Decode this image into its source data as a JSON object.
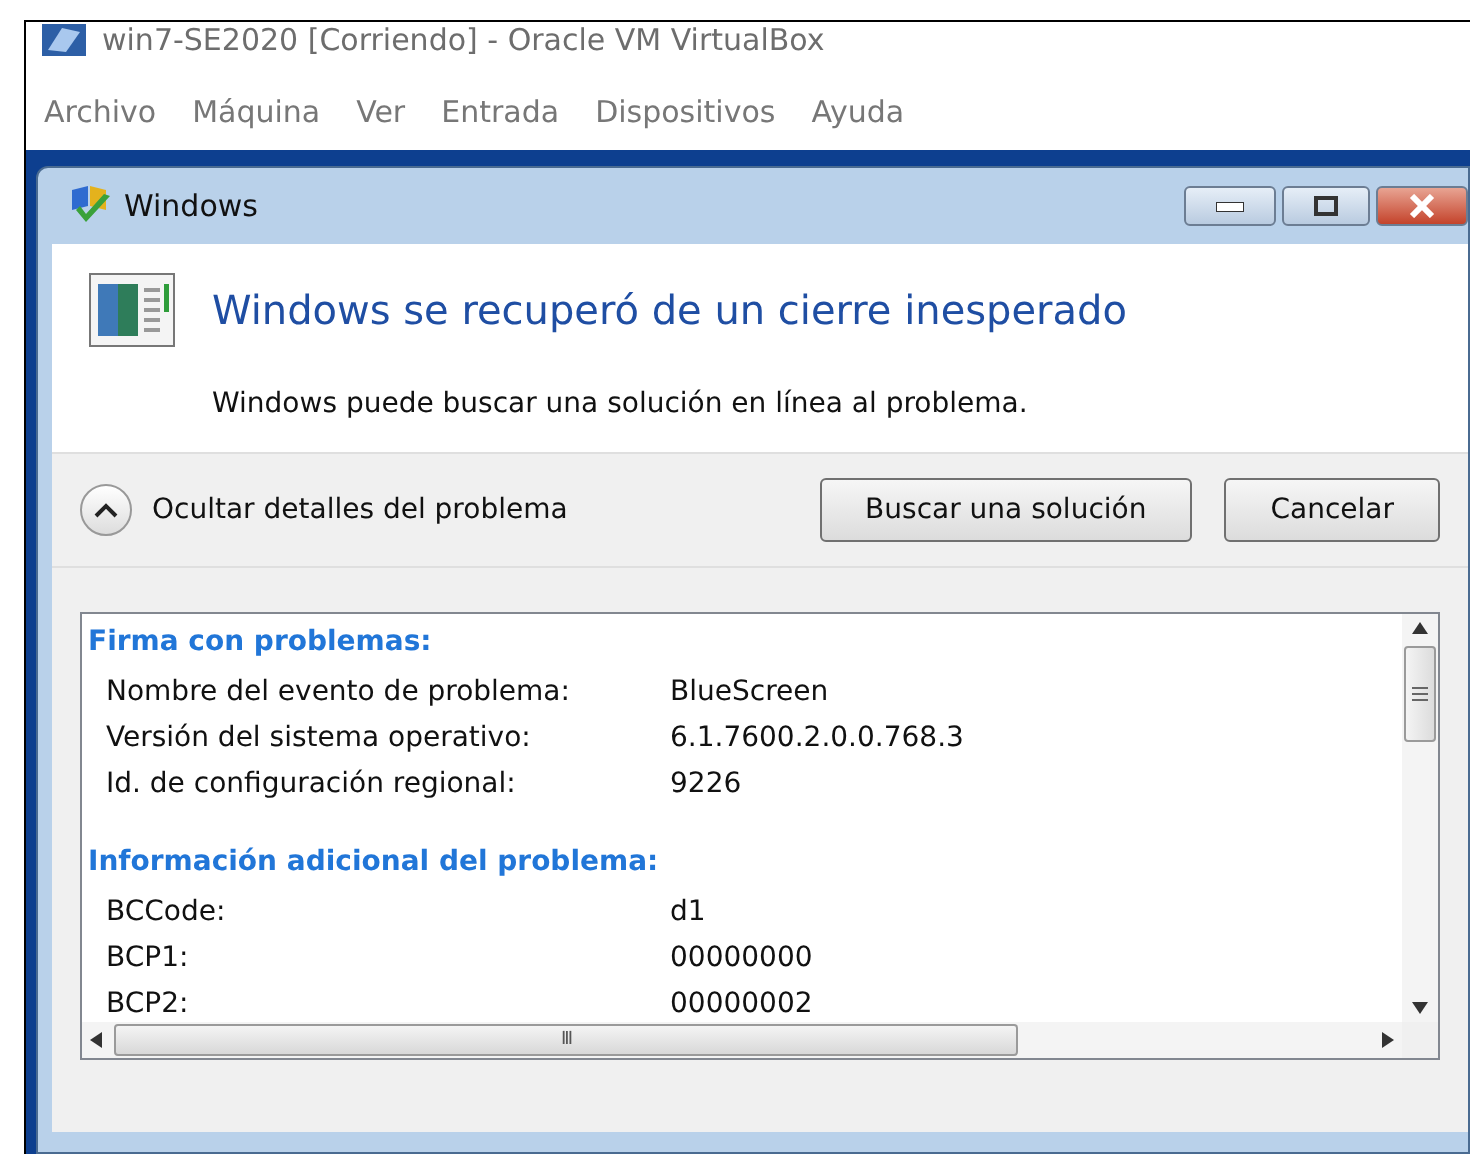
{
  "window": {
    "title": "win7-SE2020 [Corriendo] - Oracle VM VirtualBox"
  },
  "menu": [
    "Archivo",
    "Máquina",
    "Ver",
    "Entrada",
    "Dispositivos",
    "Ayuda"
  ],
  "dialog": {
    "title": "Windows",
    "heading": "Windows se recuperó de un cierre inesperado",
    "message": "Windows puede buscar una solución en línea al problema.",
    "details_toggle": {
      "label": "Ocultar detalles del problema",
      "expanded": true
    },
    "buttons": [
      "Buscar una solución",
      "Cancelar"
    ],
    "details": [
      {
        "heading": "Firma con problemas:",
        "rows": [
          {
            "label": "Nombre del evento de problema:",
            "value": "BlueScreen"
          },
          {
            "label": "Versión del sistema operativo:",
            "value": "6.1.7600.2.0.0.768.3"
          },
          {
            "label": "Id. de configuración regional:",
            "value": "9226"
          }
        ]
      },
      {
        "heading": "Información adicional del problema:",
        "rows": [
          {
            "label": "BCCode:",
            "value": "d1"
          },
          {
            "label": "BCP1:",
            "value": "00000000"
          },
          {
            "label": "BCP2:",
            "value": "00000002"
          }
        ]
      }
    ],
    "scrollbar_glyph": "III"
  }
}
